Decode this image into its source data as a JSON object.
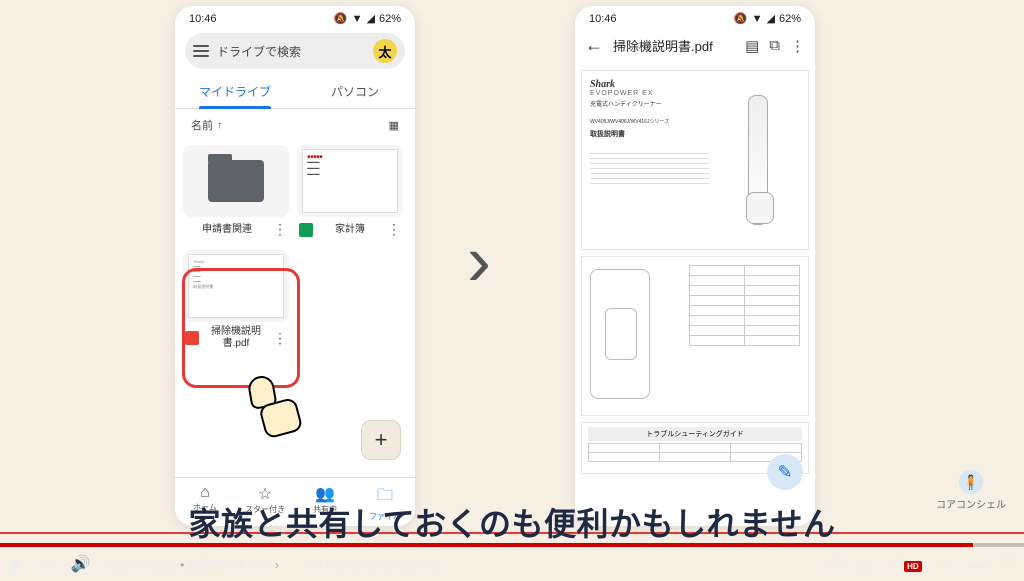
{
  "status_time": "10:46",
  "status_battery": "62%",
  "wifi_icon": "▾",
  "drive_search_placeholder": "ドライブで検索",
  "avatar_letter": "太",
  "tabs": {
    "my_drive": "マイドライブ",
    "computers": "パソコン"
  },
  "sort_label": "名前",
  "files": {
    "folder": {
      "name": "申請書関連"
    },
    "sheet": {
      "name": "家計簿"
    },
    "pdf": {
      "name": "掃除機説明書.pdf"
    }
  },
  "nav": {
    "home": "ホーム",
    "starred": "スター付き",
    "shared": "共有中",
    "files": "ファイル"
  },
  "pdf_viewer": {
    "title": "掃除機説明書.pdf",
    "brand": "Shark",
    "subbrand": "EVOPOWER EX",
    "desc": "充電式ハンディクリーナー",
    "model": "WV405J/WV406J/WV416Jシリーズ",
    "section": "取扱説明書",
    "troubleshoot": "トラブルシューティングガイド"
  },
  "chevron": "›",
  "brand_label": "コアコンシェル",
  "caption": "家族と共有しておくのも便利かもしれません",
  "player": {
    "current": "15:34",
    "total": "16:25",
    "chapter": "書類のスキャン",
    "channel": "スマホのコンシェルジュ",
    "hd": "HD"
  }
}
